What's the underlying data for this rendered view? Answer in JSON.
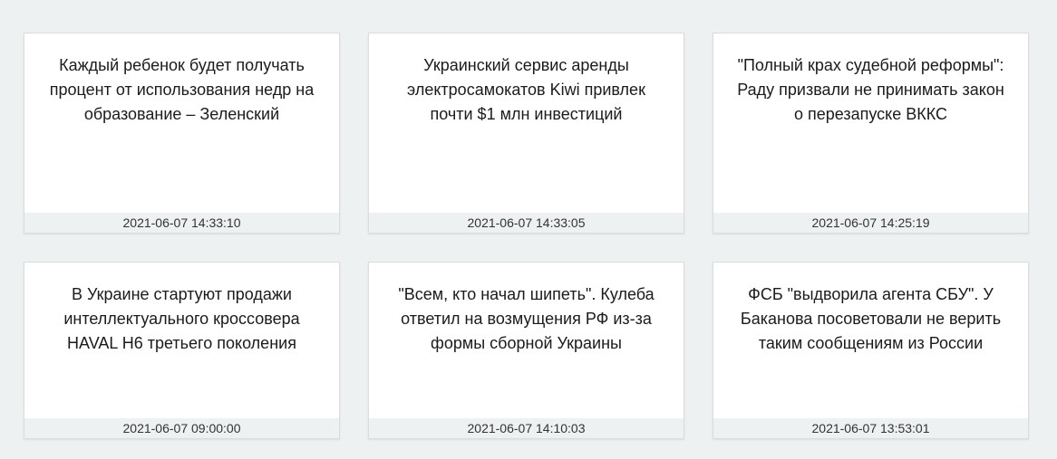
{
  "news": [
    {
      "title": "Каждый ребенок будет получать процент от использования недр на образование – Зеленский",
      "date": "2021-06-07 14:33:10"
    },
    {
      "title": "Украинский сервис аренды электросамокатов Kiwi привлек почти $1 млн инвестиций",
      "date": "2021-06-07 14:33:05"
    },
    {
      "title": "\"Полный крах судебной реформы\": Раду призвали не принимать закон о перезапуске ВККС",
      "date": "2021-06-07 14:25:19"
    },
    {
      "title": "В Украине стартуют продажи интеллектуального кроссовера HAVAL H6 третьего поколения",
      "date": "2021-06-07 09:00:00"
    },
    {
      "title": "\"Всем, кто начал шипеть\". Кулеба ответил на возмущения РФ из-за формы сборной Украины",
      "date": "2021-06-07 14:10:03"
    },
    {
      "title": "ФСБ \"выдворила агента СБУ\". У Баканова посоветовали не верить таким сообщениям из России",
      "date": "2021-06-07 13:53:01"
    }
  ]
}
